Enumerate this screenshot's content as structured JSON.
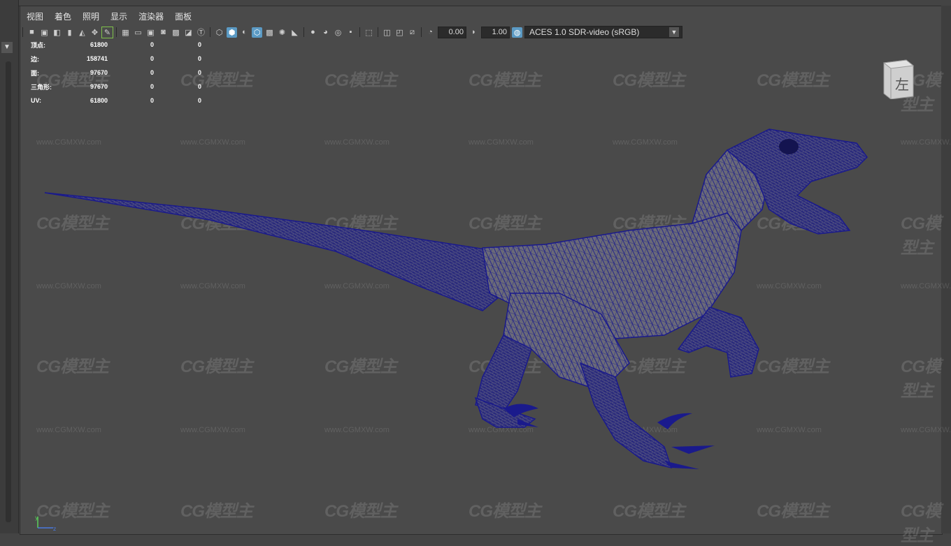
{
  "menu": [
    "视图",
    "着色",
    "照明",
    "显示",
    "渲染器",
    "面板"
  ],
  "toolbar": {
    "exposure": "0.00",
    "gamma": "1.00",
    "color_space": "ACES 1.0 SDR-video (sRGB)"
  },
  "hud": [
    {
      "label": "顶点:",
      "v1": "61800",
      "v2": "0",
      "v3": "0"
    },
    {
      "label": "边:",
      "v1": "158741",
      "v2": "0",
      "v3": "0"
    },
    {
      "label": "面:",
      "v1": "97670",
      "v2": "0",
      "v3": "0"
    },
    {
      "label": "三角形:",
      "v1": "97670",
      "v2": "0",
      "v3": "0"
    },
    {
      "label": "UV:",
      "v1": "61800",
      "v2": "0",
      "v3": "0"
    }
  ],
  "viewcube": {
    "label": "左"
  },
  "watermark": {
    "logo": "CG模型主",
    "url": "www.CGMXW.com"
  },
  "colors": {
    "mesh": "#1a1a8c",
    "mesh_fill": "#5a5a6e",
    "background": "#444444"
  }
}
